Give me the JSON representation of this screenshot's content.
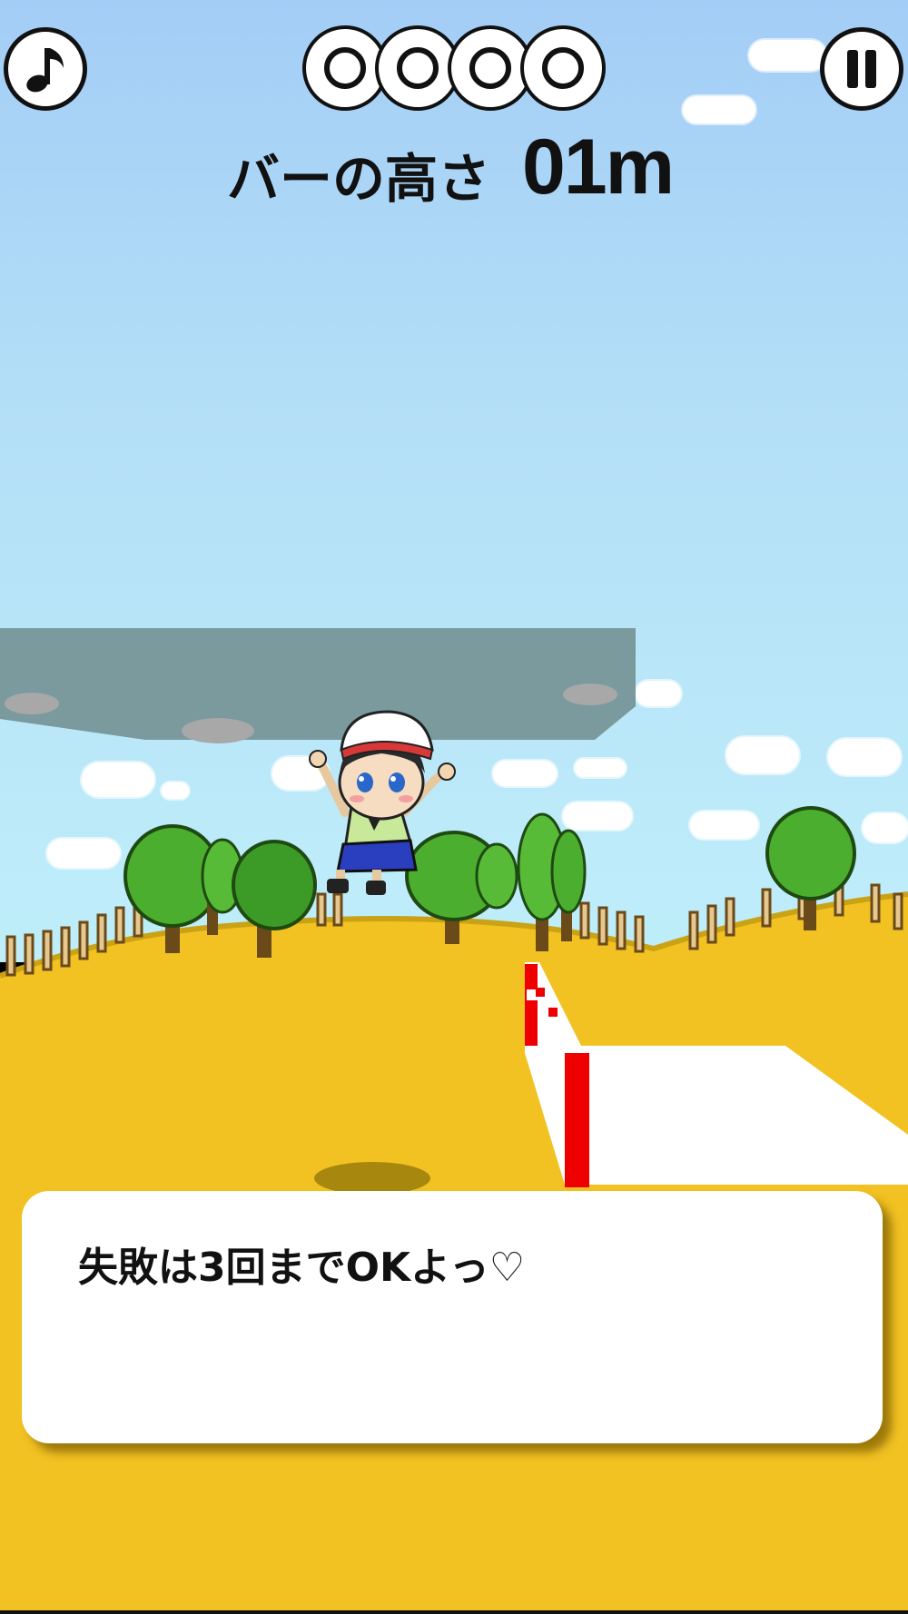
{
  "hud": {
    "music_button_icon": "music-note-icon",
    "pause_button_icon": "pause-icon",
    "attempts": {
      "remaining": 4,
      "total": 4,
      "icon": "ring-icon"
    }
  },
  "bar_height": {
    "label": "バーの高さ",
    "value": "01m"
  },
  "message": {
    "text": "失敗は3回までOKよっ♡"
  },
  "colors": {
    "sky_top": "#a3cdf6",
    "ground": "#f2c222",
    "bar_red": "#ee0000",
    "mat_white": "#ffffff"
  }
}
